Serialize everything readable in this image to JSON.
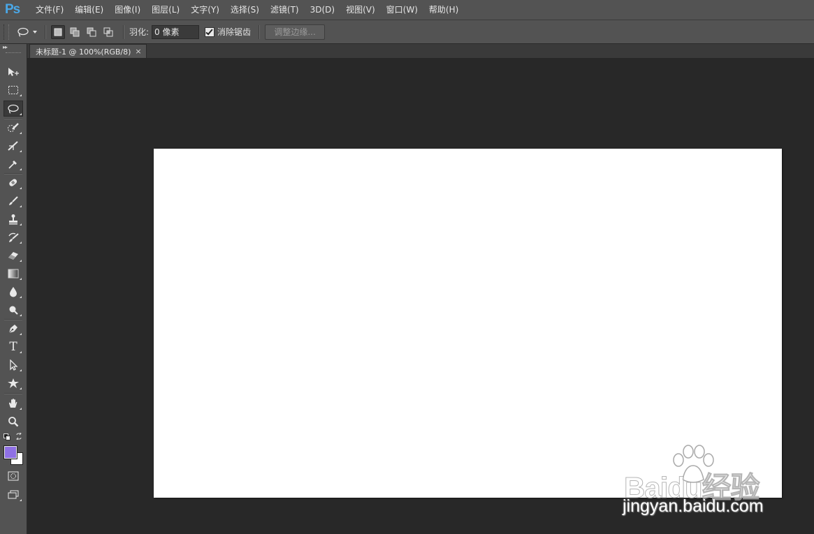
{
  "app": {
    "logo": "Ps"
  },
  "menu": [
    "文件(F)",
    "编辑(E)",
    "图像(I)",
    "图层(L)",
    "文字(Y)",
    "选择(S)",
    "滤镜(T)",
    "3D(D)",
    "视图(V)",
    "窗口(W)",
    "帮助(H)"
  ],
  "options": {
    "tool_icon": "lasso-icon",
    "selection_modes": [
      "new-selection",
      "add-to-selection",
      "subtract-from-selection",
      "intersect-selection"
    ],
    "feather_label": "羽化:",
    "feather_value": "0 像素",
    "antialias_label": "消除锯齿",
    "antialias_checked": true,
    "refine_edge_label": "调整边缘..."
  },
  "document": {
    "tab_title": "未标题-1 @ 100%(RGB/8)",
    "close_symbol": "×",
    "canvas_color": "#ffffff"
  },
  "toolbar": {
    "collapse_symbol": "▸▸",
    "tools": [
      "move-tool",
      "rectangular-marquee-tool",
      "lasso-tool",
      "quick-selection-tool",
      "crop-tool",
      "eyedropper-tool",
      "spot-healing-brush-tool",
      "brush-tool",
      "clone-stamp-tool",
      "history-brush-tool",
      "eraser-tool",
      "gradient-tool",
      "blur-tool",
      "dodge-tool",
      "pen-tool",
      "type-tool",
      "path-selection-tool",
      "custom-shape-tool",
      "hand-tool",
      "zoom-tool"
    ],
    "active_tool": "lasso-tool",
    "type_glyph": "T",
    "foreground_color": "#8f70e4",
    "background_color": "#ffffff"
  },
  "watermark": {
    "logo_text": "Baidu经验",
    "url": "jingyan.baidu.com"
  }
}
